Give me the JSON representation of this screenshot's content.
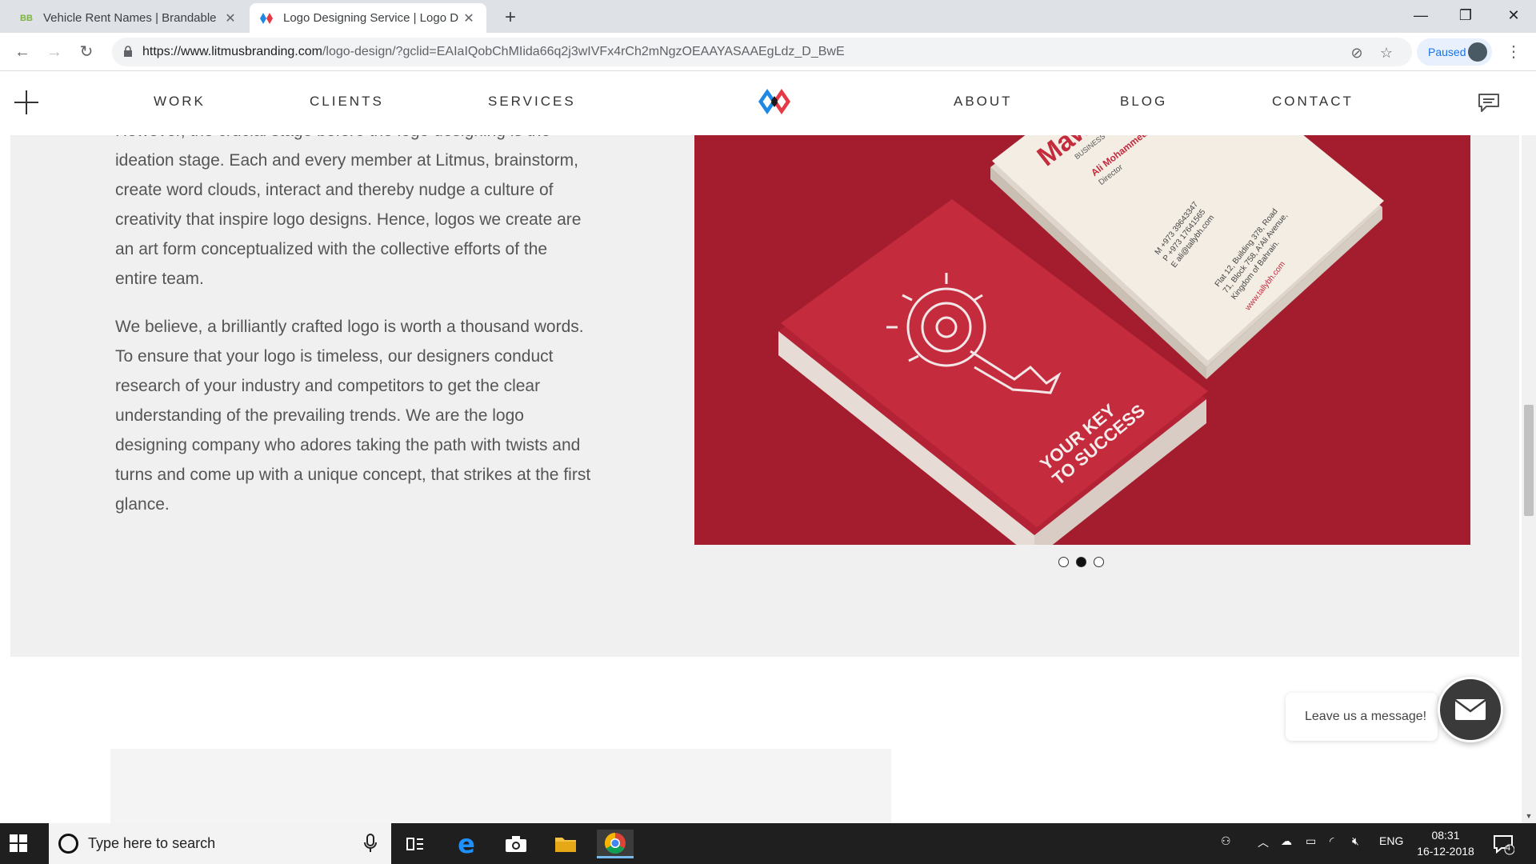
{
  "browser": {
    "tabs": [
      {
        "label": "Vehicle Rent Names | Brandable",
        "favicon": "BB",
        "active": false
      },
      {
        "label": "Logo Designing Service | Logo D",
        "favicon": "litmus-logo",
        "active": true
      }
    ],
    "url_domain": "https://www.litmusbranding.com",
    "url_path": "/logo-design/?gclid=EAIaIQobChMIida66q2j3wIVFx4rCh2mNgzOEAAYASAAEgLdz_D_BwE",
    "profile_label": "Paused"
  },
  "site": {
    "nav_left": [
      "WORK",
      "CLIENTS",
      "SERVICES"
    ],
    "nav_right": [
      "ABOUT",
      "BLOG",
      "CONTACT"
    ],
    "paragraph1_lines": [
      "However, the crucial stage before the logo designing is the",
      "ideation stage. Each and every member at Litmus, brainstorm,",
      "create word clouds, interact and thereby nudge a culture of",
      "creativity that inspire logo designs. Hence, logos we create are",
      "an art form conceptualized with the collective efforts of the",
      "entire team."
    ],
    "paragraph2_lines": [
      "We believe, a brilliantly crafted logo is worth a thousand words.",
      "To ensure that your logo is timeless, our designers conduct",
      "research of your industry and competitors to get the clear",
      "understanding of the prevailing trends. We are the logo",
      "designing company who adores taking the path with twists and",
      "turns and come up with a unique concept, that strikes at the first",
      "glance."
    ],
    "card_front_text_1": "YOUR KEY",
    "card_front_text_2": "TO SUCCESS",
    "card_back": {
      "brand": "Mawa",
      "tagline": "BUSINESS SOLU",
      "name": "Ali Mohammed",
      "title": "Director",
      "phone_m": "M  +973 39643347",
      "phone_p": "P  +973 17641565",
      "email": "E  ali@tallybh.com",
      "address1": "Flat 12, Building 378, Road",
      "address2": "71, Block 758, A'Ali Avenue,",
      "address3": "Kingdom of Bahrain.",
      "website": "www.tallybh.com"
    },
    "carousel_active_index": 1,
    "carousel_count": 3,
    "chat_prompt": "Leave us a message!"
  },
  "taskbar": {
    "search_placeholder": "Type here to search",
    "lang": "ENG",
    "time": "08:31",
    "date": "16-12-2018",
    "notification_count": "4"
  },
  "colors": {
    "brand_red": "#e63946",
    "brand_blue": "#1e88e5",
    "photo_bg": "#a31d2e",
    "card_red": "#c42b3d"
  }
}
